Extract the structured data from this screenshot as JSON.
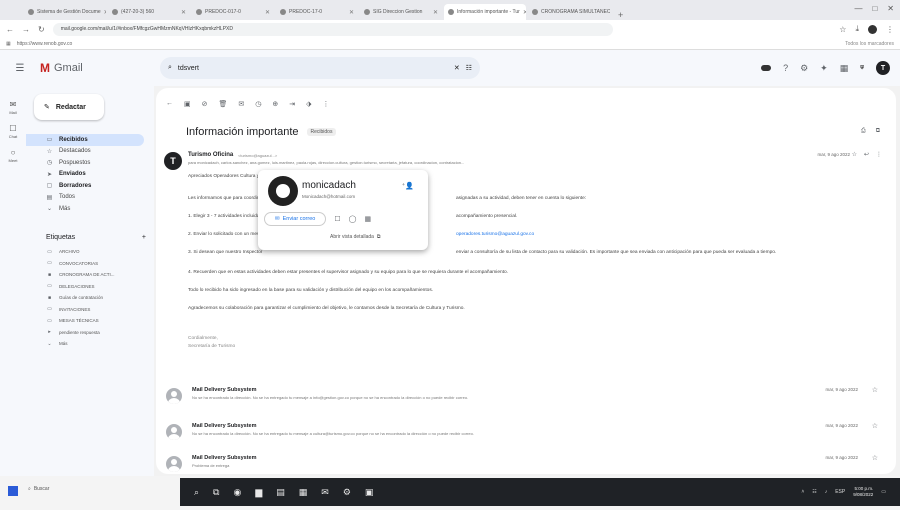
{
  "browser": {
    "tabs": [
      {
        "title": "Sistema de Gestión Docume"
      },
      {
        "title": "(427-20-3) 560"
      },
      {
        "title": "PREDOC-017-0"
      },
      {
        "title": "PREDOC-17-0"
      },
      {
        "title": "SIG Direccion Gestion"
      },
      {
        "title": "Información importante - Tur"
      },
      {
        "title": "CRONOGRAMA SIMULTANEO"
      }
    ],
    "new_tab": "+",
    "window_controls": [
      "—",
      "□",
      "✕"
    ],
    "url": "mail.google.com/mail/u/1/#inbox/FMfcgzGwHMzmNKqVHlzHKxqbmkzHLPXD",
    "bookmark": "https://www.renob.gov.co",
    "bookmarks_right": "Todos los marcadores"
  },
  "gmail": {
    "brand": "Gmail",
    "search_value": "tdsvert",
    "rail": [
      {
        "icon": "✉",
        "label": "Mail"
      },
      {
        "icon": "☐",
        "label": "Chat"
      },
      {
        "icon": "○",
        "label": "Meet"
      }
    ],
    "compose_label": "Redactar",
    "nav": [
      {
        "icon": "▭",
        "label": "Recibidos",
        "bold": true,
        "active": true
      },
      {
        "icon": "☆",
        "label": "Destacados",
        "bold": false,
        "active": false
      },
      {
        "icon": "◷",
        "label": "Pospuestos",
        "bold": false,
        "active": false
      },
      {
        "icon": "➤",
        "label": "Enviados",
        "bold": true,
        "active": false
      },
      {
        "icon": "▢",
        "label": "Borradores",
        "bold": true,
        "active": false
      },
      {
        "icon": "▤",
        "label": "Todos",
        "bold": false,
        "active": false
      },
      {
        "icon": "⌄",
        "label": "Más",
        "bold": false,
        "active": false
      }
    ],
    "labels_title": "Etiquetas",
    "labels_add": "+",
    "labels": [
      "ARCHIVO",
      "CONVOCATORIAS",
      "CRONOGRAMA DE ACTI...",
      "DELEGACIONES",
      "Guías de contratación",
      "INVITACIONES",
      "MESAS TÉCNICAS",
      "pendiente respuesta",
      "Más"
    ]
  },
  "message": {
    "subject": "Información importante",
    "subject_chip": "Recibidos",
    "sender_initial": "T",
    "sender_name": "Turismo Oficina",
    "sender_email": "<turismo@aguazul...>",
    "recipients_line": "para monicadach, carlos.sanchez, ana.gomez, luis.martinez, paola.rojas, direccion.cultura, gestion.turismo, secretaria, jefatura, coordinacion, contratacion...",
    "date": "mar, 9 ago 2022",
    "body": {
      "salutation": "Apreciados Operadores Cultura y Turismo",
      "p1_left": "Les informamos que para coordinar",
      "p1_right": "asignadas a su actividad, deben tener en cuenta lo siguiente:",
      "l1_left": "1. Elegir 3 - 7 actividades incluidas",
      "l1_right": "acompañamiento presencial.",
      "l2_left": "2. Enviar lo solicitado con un mes",
      "l2_right": "operadores.turismo@aguazul.gov.co",
      "l3_left": "3. Si desean que nuestro Inspector",
      "l3_right": "enviar a consultoría de su lista de contacto para su validación. Es importante que sea enviada con anticipación para que pueda ser evaluada a tiempo.",
      "l4": "4. Recuerden que en estas actividades deben estar presentes el supervisor asignado y su equipo para lo que se requiera durante el acompañamiento.",
      "p2": "Todo lo recibido ha sido ingresado en la base para su validación y distribución del equipo en los acompañamientos.",
      "p3": "Agradecemos su colaboración para garantizar el cumplimiento del objetivo, le contamos desde la Secretaría de Cultura y Turismo.",
      "sig1": "Cordialmente,",
      "sig2": "Secretaría de Turismo"
    }
  },
  "hovercard": {
    "name": "monicadach",
    "email": "Monicadach@hotmail.com",
    "send_label": "Enviar correo",
    "detail_label": "Abrir vista detallada"
  },
  "deliveries": [
    {
      "name": "Mail Delivery Subsystem",
      "snippet": "No se ha encontrado la dirección. No se ha entregado tu mensaje a info@gestion.gov.co porque no se ha encontrado la dirección o no puede recibir correo.",
      "date": "mar, 9 ago 2022"
    },
    {
      "name": "Mail Delivery Subsystem",
      "snippet": "No se ha encontrado la dirección. No se ha entregado tu mensaje a cultura@turismo.gov.co porque no se ha encontrado la dirección o no puede recibir correo.",
      "date": "mar, 9 ago 2022"
    },
    {
      "name": "Mail Delivery Subsystem",
      "snippet": "Problema de entrega",
      "date": "mar, 9 ago 2022"
    }
  ],
  "taskbar": {
    "search": "Buscar",
    "time": "5:00 p.m.",
    "date": "9/08/2022",
    "lang": "ESP"
  }
}
